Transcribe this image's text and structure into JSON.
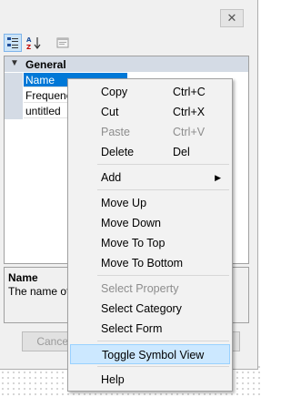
{
  "window": {
    "close_icon": "close-icon"
  },
  "toolbar": [
    {
      "id": "categorized",
      "icon": "categorized-icon",
      "active": true
    },
    {
      "id": "alphabetical",
      "icon": "sort-az-icon",
      "active": false
    },
    {
      "id": "property-pages",
      "icon": "property-pages-icon",
      "active": false
    }
  ],
  "grid": {
    "category": "General",
    "rows": [
      "Name",
      "Frequenc",
      "untitled"
    ],
    "selected_row": "Name"
  },
  "help": {
    "title": "Name",
    "description": "The name of t"
  },
  "buttons": {
    "cancel": "Cancel"
  },
  "context_menu": {
    "groups": [
      [
        {
          "label": "Copy",
          "shortcut": "Ctrl+C",
          "enabled": true
        },
        {
          "label": "Cut",
          "shortcut": "Ctrl+X",
          "enabled": true
        },
        {
          "label": "Paste",
          "shortcut": "Ctrl+V",
          "enabled": false
        },
        {
          "label": "Delete",
          "shortcut": "Del",
          "enabled": true
        }
      ],
      [
        {
          "label": "Add",
          "submenu": true,
          "enabled": true
        }
      ],
      [
        {
          "label": "Move Up",
          "enabled": true
        },
        {
          "label": "Move Down",
          "enabled": true
        },
        {
          "label": "Move To Top",
          "enabled": true
        },
        {
          "label": "Move To Bottom",
          "enabled": true
        }
      ],
      [
        {
          "label": "Select Property",
          "enabled": false
        },
        {
          "label": "Select Category",
          "enabled": true
        },
        {
          "label": "Select Form",
          "enabled": true
        }
      ],
      [
        {
          "label": "Toggle Symbol View",
          "enabled": true,
          "hovered": true
        }
      ],
      [
        {
          "label": "Help",
          "enabled": true
        }
      ]
    ]
  }
}
